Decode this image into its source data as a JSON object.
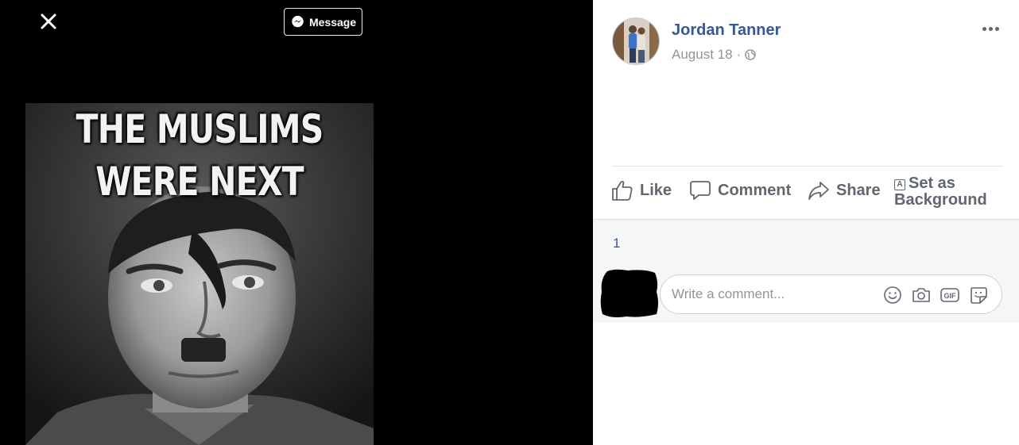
{
  "viewer": {
    "message_button": "Message",
    "meme_text": [
      "THE MUSLIMS",
      "WERE NEXT"
    ]
  },
  "post": {
    "author": "Jordan Tanner",
    "date": "August 18",
    "separator": "·",
    "privacy_icon": "globe-icon",
    "actions": {
      "like": "Like",
      "comment": "Comment",
      "share": "Share",
      "set_background": "Set as Background"
    }
  },
  "comments": {
    "count": "1",
    "placeholder": "Write a comment...",
    "icons": [
      "emoji-icon",
      "camera-icon",
      "gif-icon",
      "sticker-icon"
    ]
  },
  "colors": {
    "link": "#365899",
    "muted": "#606770",
    "viewer_bg": "#000000"
  }
}
